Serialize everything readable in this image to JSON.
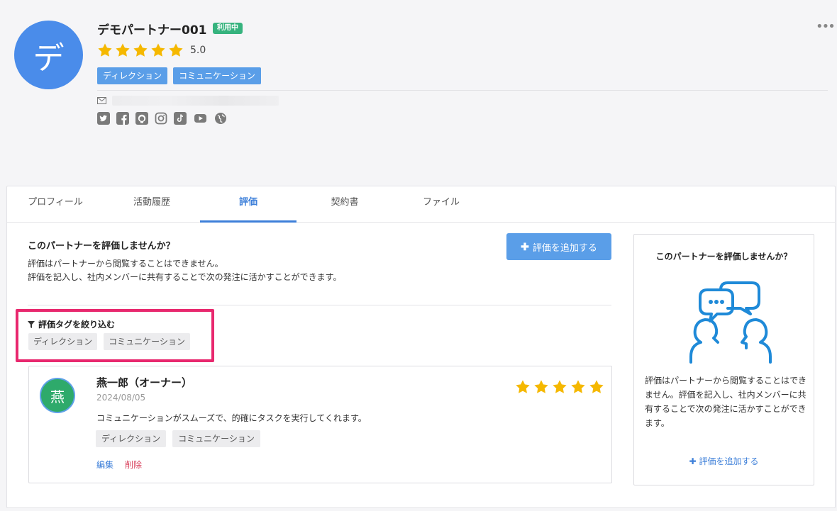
{
  "partner": {
    "avatar_char": "デ",
    "name": "デモパートナー001",
    "status": "利用中",
    "rating": 5,
    "rating_text": "5.0",
    "tags": [
      "ディレクション",
      "コミュニケーション"
    ],
    "social_icons": [
      "twitter-icon",
      "facebook-icon",
      "github-icon",
      "instagram-icon",
      "tiktok-icon",
      "youtube-icon",
      "website-icon"
    ],
    "more_icon": "•••"
  },
  "tabs": [
    {
      "label": "プロフィール",
      "active": false
    },
    {
      "label": "活動履歴",
      "active": false
    },
    {
      "label": "評価",
      "active": true
    },
    {
      "label": "契約書",
      "active": false
    },
    {
      "label": "ファイル",
      "active": false
    }
  ],
  "main": {
    "title": "このパートナーを評価しませんか？",
    "desc1": "評価はパートナーから閲覧することはできません。",
    "desc2": "評価を記入し、社内メンバーに共有することで次の発注に活かすことができます。",
    "add_button": "評価を追加する",
    "filter_title": "評価タグを絞り込む",
    "filter_tags": [
      "ディレクション",
      "コミュニケーション"
    ]
  },
  "review": {
    "avatar_char": "燕",
    "name": "燕一郎（オーナー）",
    "date": "2024/08/05",
    "rating": 5,
    "text": "コミュニケーションがスムーズで、的確にタスクを実行してくれます。",
    "tags": [
      "ディレクション",
      "コミュニケーション"
    ],
    "edit_label": "編集",
    "delete_label": "削除"
  },
  "side": {
    "title": "このパートナーを評価しませんか？",
    "desc": "評価はパートナーから閲覧することはできません。評価を記入し、社内メンバーに共有することで次の発注に活かすことができます。",
    "add_link": "評価を追加する"
  },
  "colors": {
    "accent": "#3d7fd9",
    "button": "#5a9ee8",
    "star": "#f5b800",
    "status": "#36b37e",
    "highlight": "#e8286e",
    "delete": "#d9425d"
  }
}
